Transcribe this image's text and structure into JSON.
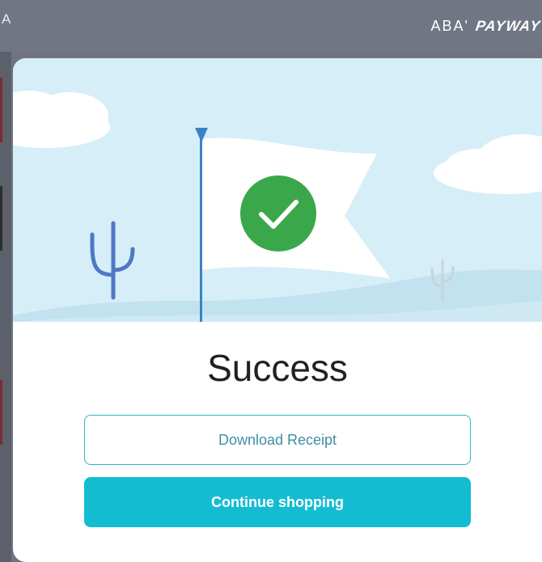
{
  "header": {
    "corner_letter": "A",
    "brand_part1": "ABA'",
    "brand_part2": "PAYWAY"
  },
  "status": {
    "title": "Success",
    "icon": "checkmark-icon",
    "icon_color": "#3aa84a"
  },
  "actions": {
    "download_label": "Download Receipt",
    "continue_label": "Continue shopping"
  },
  "colors": {
    "accent": "#14bcd2",
    "sky": "#d6eef8",
    "cactus_near": "#4f78c4",
    "cactus_far": "#c9d2dd",
    "flagpole": "#3c82c4"
  }
}
